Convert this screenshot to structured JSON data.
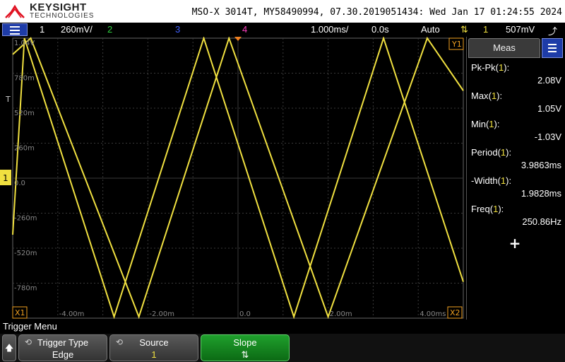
{
  "header": {
    "brand": "KEYSIGHT",
    "brand_sub": "TECHNOLOGIES",
    "instrument_info": "MSO-X 3014T, MY58490994, 07.30.2019051434: Wed Jan 17 01:24:55 2024"
  },
  "status_bar": {
    "ch1_num": "1",
    "ch1_scale": "260mV/",
    "ch2_num": "2",
    "ch3_num": "3",
    "ch4_num": "4",
    "timebase": "1.000ms/",
    "delay": "0.0s",
    "trigger_mode": "Auto",
    "trigger_source": "1",
    "trigger_level": "507mV",
    "colors": {
      "ch1": "#f0e040",
      "ch2": "#30d040",
      "ch3": "#4060ff",
      "ch4": "#ff40c0"
    }
  },
  "graticule": {
    "y_labels": [
      "1.04V",
      "780m",
      "520m",
      "260m",
      "0.0",
      "-260m",
      "-520m",
      "-780m"
    ],
    "x_labels": [
      "-4.00m",
      "-2.00m",
      "0.0",
      "2.00m",
      "4.00ms"
    ],
    "marker_y1": "Y1",
    "marker_x1": "X1",
    "marker_x2": "X2",
    "trigger_marker": "T",
    "ground_marker": "1"
  },
  "chart_data": {
    "type": "line",
    "title": "",
    "series": [
      {
        "name": "",
        "color": "#f0e040",
        "x_ms": [
          -5.0,
          -4.74,
          -2.75,
          -0.76,
          1.24,
          3.23,
          5.0
        ],
        "y_v": [
          -0.42,
          1.04,
          -1.03,
          1.04,
          -1.03,
          1.04,
          -0.77
        ]
      },
      {
        "name": "",
        "color": "#f0e040",
        "x_ms": [
          -5.0,
          -4.6,
          -2.2,
          -0.2,
          2.0,
          4.2,
          5.0
        ],
        "y_v": [
          0.92,
          1.04,
          -1.03,
          1.04,
          -1.03,
          1.04,
          0.65
        ]
      }
    ],
    "xlim": [
      -5.0,
      5.0
    ],
    "ylim": [
      -1.04,
      1.04
    ]
  },
  "measurements": {
    "tab_label": "Meas",
    "items": [
      {
        "name": "Pk-Pk",
        "channel": "1",
        "value": "2.08V"
      },
      {
        "name": "Max",
        "channel": "1",
        "value": "1.05V"
      },
      {
        "name": "Min",
        "channel": "1",
        "value": "-1.03V"
      },
      {
        "name": "Period",
        "channel": "1",
        "value": "3.9863ms"
      },
      {
        "name": "-Width",
        "channel": "1",
        "value": "1.9828ms"
      },
      {
        "name": "Freq",
        "channel": "1",
        "value": "250.86Hz"
      }
    ],
    "add_label": "+"
  },
  "softkeys": {
    "menu_title": "Trigger Menu",
    "back": "🡅",
    "trigger_type_label": "Trigger Type",
    "trigger_type_value": "Edge",
    "source_label": "Source",
    "source_value": "1",
    "slope_label": "Slope",
    "slope_value": "⇅"
  }
}
